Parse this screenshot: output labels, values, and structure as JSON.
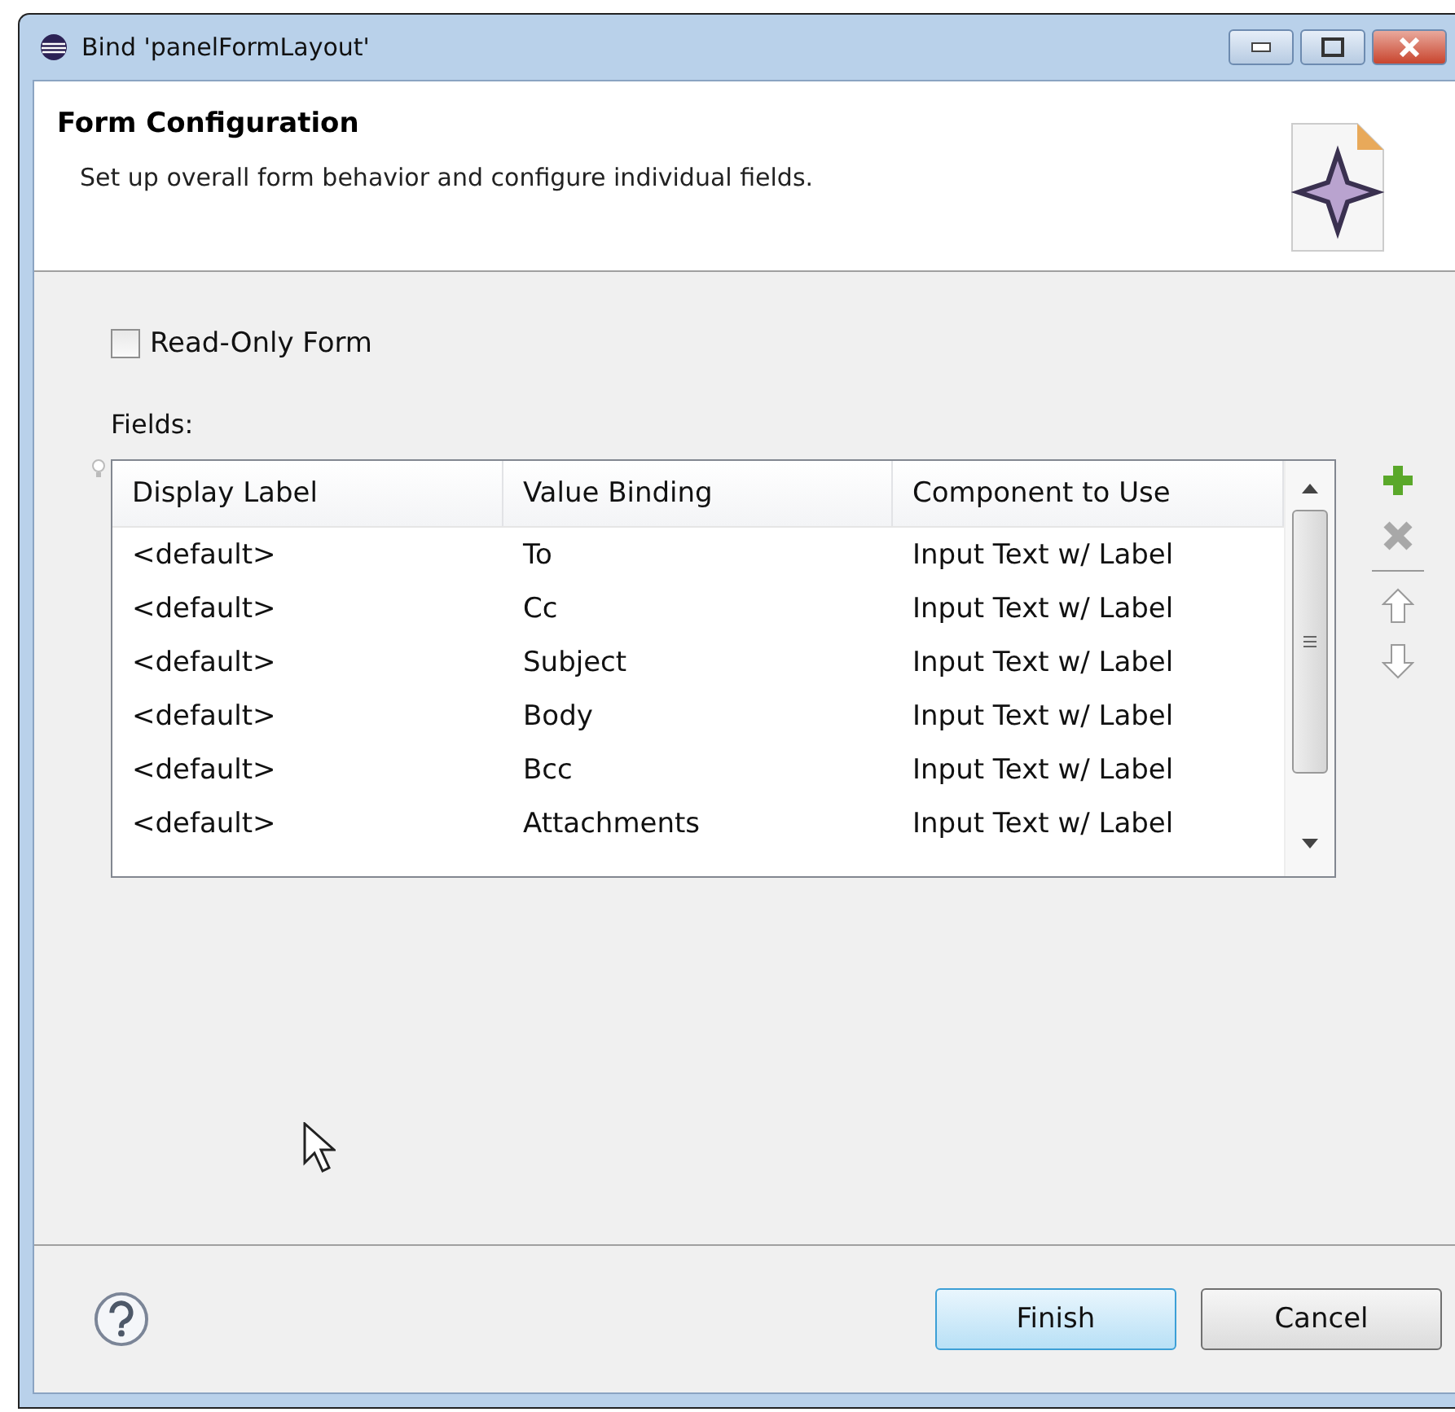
{
  "window": {
    "title": "Bind 'panelFormLayout'"
  },
  "header": {
    "title": "Form Configuration",
    "description": "Set up overall form behavior and configure individual fields."
  },
  "read_only": {
    "label": "Read-Only Form",
    "checked": false
  },
  "fields": {
    "label": "Fields:",
    "columns": [
      "Display Label",
      "Value Binding",
      "Component to Use"
    ],
    "rows": [
      {
        "cells": [
          "<default>",
          "To",
          "Input Text w/ Label"
        ]
      },
      {
        "cells": [
          "<default>",
          "Cc",
          "Input Text w/ Label"
        ]
      },
      {
        "cells": [
          "<default>",
          "Subject",
          "Input Text w/ Label"
        ]
      },
      {
        "cells": [
          "<default>",
          "Body",
          "Input Text w/ Label"
        ]
      },
      {
        "cells": [
          "<default>",
          "Bcc",
          "Input Text w/ Label"
        ]
      },
      {
        "cells": [
          "<default>",
          "Attachments",
          "Input Text w/ Label"
        ]
      }
    ],
    "actions": [
      {
        "kind": "add",
        "disabled": false
      },
      {
        "kind": "remove",
        "disabled": true
      },
      {
        "kind": "separator"
      },
      {
        "kind": "up",
        "disabled": true
      },
      {
        "kind": "down",
        "disabled": true
      }
    ]
  },
  "buttons": [
    {
      "label": "Finish",
      "selected": true
    },
    {
      "label": "Cancel",
      "selected": false
    }
  ]
}
